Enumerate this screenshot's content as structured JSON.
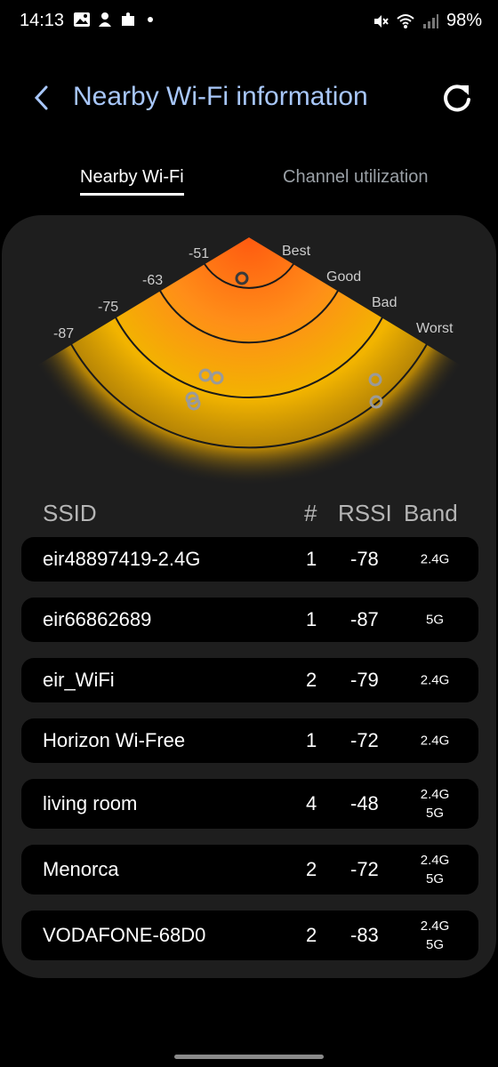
{
  "status_bar": {
    "time": "14:13",
    "battery": "98%"
  },
  "header": {
    "title": "Nearby Wi-Fi information"
  },
  "tabs": [
    {
      "label": "Nearby Wi-Fi",
      "active": true
    },
    {
      "label": "Channel utilization",
      "active": false
    }
  ],
  "radar": {
    "ring_labels": [
      "-51",
      "-63",
      "-75",
      "-87"
    ],
    "quality_labels": [
      "Best",
      "Good",
      "Bad",
      "Worst"
    ]
  },
  "table": {
    "headers": {
      "ssid": "SSID",
      "num": "#",
      "rssi": "RSSI",
      "band": "Band"
    },
    "rows": [
      {
        "ssid": "eir48897419-2.4G",
        "num": "1",
        "rssi": "-78",
        "band": [
          "2.4G"
        ]
      },
      {
        "ssid": "eir66862689",
        "num": "1",
        "rssi": "-87",
        "band": [
          "5G"
        ]
      },
      {
        "ssid": "eir_WiFi",
        "num": "2",
        "rssi": "-79",
        "band": [
          "2.4G"
        ]
      },
      {
        "ssid": "Horizon Wi-Free",
        "num": "1",
        "rssi": "-72",
        "band": [
          "2.4G"
        ]
      },
      {
        "ssid": "living room",
        "num": "4",
        "rssi": "-48",
        "band": [
          "2.4G",
          "5G"
        ]
      },
      {
        "ssid": "Menorca",
        "num": "2",
        "rssi": "-72",
        "band": [
          "2.4G",
          "5G"
        ]
      },
      {
        "ssid": "VODAFONE-68D0",
        "num": "2",
        "rssi": "-83",
        "band": [
          "2.4G",
          "5G"
        ]
      }
    ]
  },
  "colors": {
    "title_accent": "#a8c7fa",
    "radar_core": "#ff5a10",
    "radar_edge": "#f2b400"
  },
  "icons": [
    "back-chevron-icon",
    "refresh-icon",
    "gallery-icon",
    "notification-icon",
    "puzzle-icon",
    "mute-icon",
    "wifi-icon",
    "signal-icon"
  ]
}
